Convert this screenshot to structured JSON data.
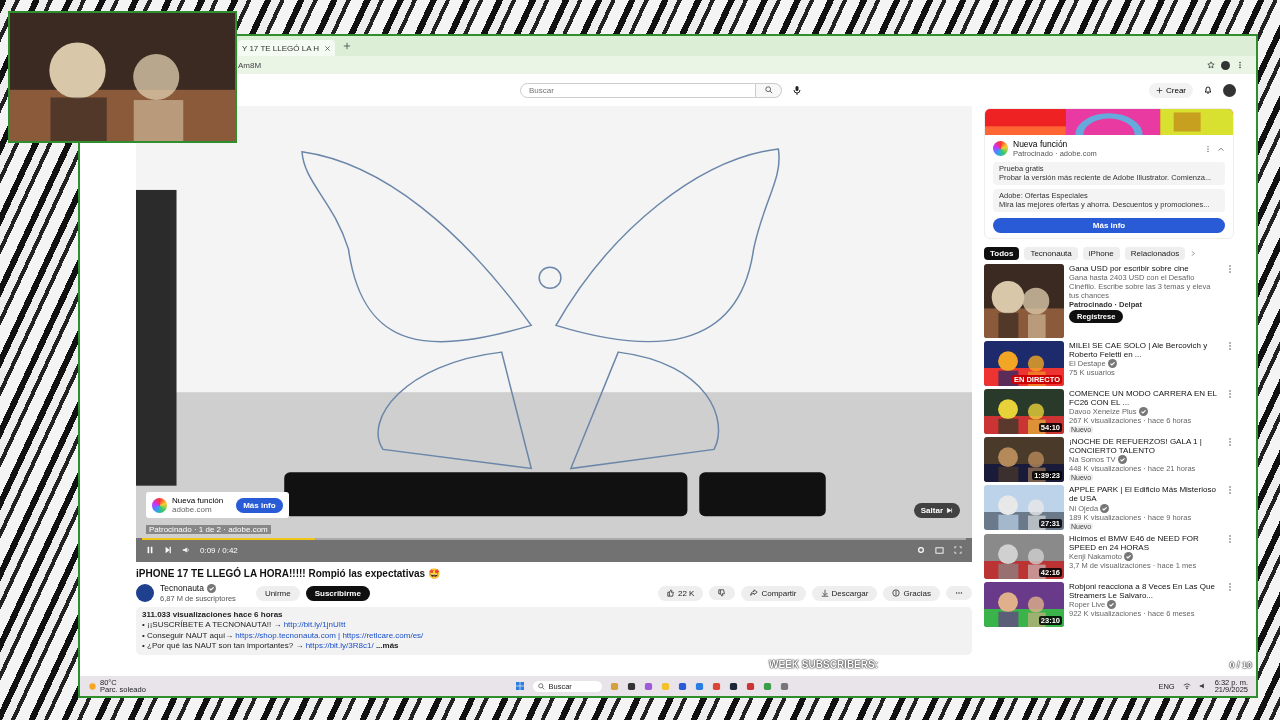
{
  "browser": {
    "tab_title": "Y 17 TE LLEGÓ LA H",
    "address": "Am8M"
  },
  "header": {
    "search": {
      "placeholder": "Buscar"
    },
    "create": "Crear"
  },
  "player": {
    "ad_card": {
      "title": "Nueva función",
      "domain": "adobe.com",
      "button": "Más info"
    },
    "ad_info": "Patrocinado · 1 de 2 · adobe.com",
    "skip": "Saltar",
    "time": "0:09 / 0:42",
    "level": 0.21
  },
  "video": {
    "title": "iPHONE 17 TE LLEGÓ LA HORA!!!!! Rompió las expectativas 🤩",
    "channel": "Tecnonauta",
    "verified": true,
    "subscribers": "6,87 M de suscriptores",
    "join": "Unirme",
    "subscribe": "Suscribirme",
    "likes": "22 K",
    "share": "Compartir",
    "download": "Descargar",
    "thanks": "Gracias"
  },
  "description": {
    "stats": "311.033 visualizaciones  hace 6 horas",
    "lines": [
      {
        "text": "• ¡¡SUSCRÍBETE A TECNONAUTA!! → ",
        "link": "http://bit.ly/1jnUItt"
      },
      {
        "text": "• Conseguir NAUT aquí→ ",
        "link": "https://shop.tecnonauta.com | https://retlcare.com/es/"
      },
      {
        "text": "• ¿Por qué las NAUT son tan importantes? → ",
        "link": "https://bit.ly/3R8c1/",
        "more": "...más"
      }
    ]
  },
  "sidebar_ad": {
    "title": "Nueva función",
    "sponsor": "Patrocinado · adobe.com",
    "offers": [
      {
        "title": "Prueba gratis",
        "text": "Probar la versión más reciente de Adobe Illustrator. Comienza..."
      },
      {
        "title": "Adobe: Ofertas Especiales",
        "text": "Mira las mejores ofertas y ahorra. Descuentos y promociones..."
      }
    ],
    "button": "Más info"
  },
  "chips": [
    {
      "label": "Todos",
      "selected": true
    },
    {
      "label": "Tecnonauta",
      "selected": false
    },
    {
      "label": "iPhone",
      "selected": false
    },
    {
      "label": "Relacionados",
      "selected": false
    }
  ],
  "recommendations": [
    {
      "kind": "ad",
      "title": "Gana USD por escribir sobre cine",
      "text": "Gana hasta 2403 USD con el Desafío Cinéfilo. Escribe sobre las 3 temas y eleva tus chances",
      "sponsor": "Patrocinado · Delpat",
      "button": "Regístrese"
    },
    {
      "kind": "live",
      "title": "MILEI SE CAE SOLO | Ale Bercovich y Roberto Feletti en ...",
      "channel": "El Destape",
      "verified": true,
      "meta": "75 K usuarios",
      "badge": "EN DIRECTO"
    },
    {
      "kind": "video",
      "title": "COMENCE UN MODO CARRERA EN EL FC26 CON EL ...",
      "channel": "Davoo Xeneize Plus",
      "verified": true,
      "meta": "267 K visualizaciones · hace 6 horas",
      "duration": "54:10",
      "new": "Nuevo"
    },
    {
      "kind": "video",
      "title": "¡NOCHE DE REFUERZOS! GALA 1 | CONCIERTO TALENTO",
      "channel": "Na Somos TV",
      "verified": true,
      "meta": "448 K visualizaciones · hace 21 horas",
      "duration": "1:39:23",
      "new": "Nuevo"
    },
    {
      "kind": "video",
      "title": "APPLE PARK | El Edificio Más Misterioso de USA",
      "channel": "Ni Ojeda",
      "verified": true,
      "meta": "189 K visualizaciones · hace 9 horas",
      "duration": "27:31",
      "new": "Nuevo"
    },
    {
      "kind": "video",
      "title": "Hicimos el BMW E46 de NEED FOR SPEED en 24 HORAS",
      "channel": "Kenji Nakamoto",
      "verified": true,
      "meta": "3,7 M de visualizaciones · hace 1 mes",
      "duration": "42:16"
    },
    {
      "kind": "video",
      "title": "Robjoni reacciona a 8 Veces En Las Que Streamers Le Salvaro...",
      "channel": "Roper Live",
      "verified": true,
      "meta": "922 K visualizaciones · hace 6 meses",
      "duration": "23:10"
    }
  ],
  "overlay": {
    "subscribers_label": "WEEK SUBSCRIBERS:",
    "counter": "0 / 10"
  },
  "taskbar": {
    "weather": "80°C",
    "weather_text": "Parc. soleado",
    "search": "Buscar",
    "language": "ENG",
    "time": "6:32 p. m.",
    "date": "21/9/2025"
  }
}
